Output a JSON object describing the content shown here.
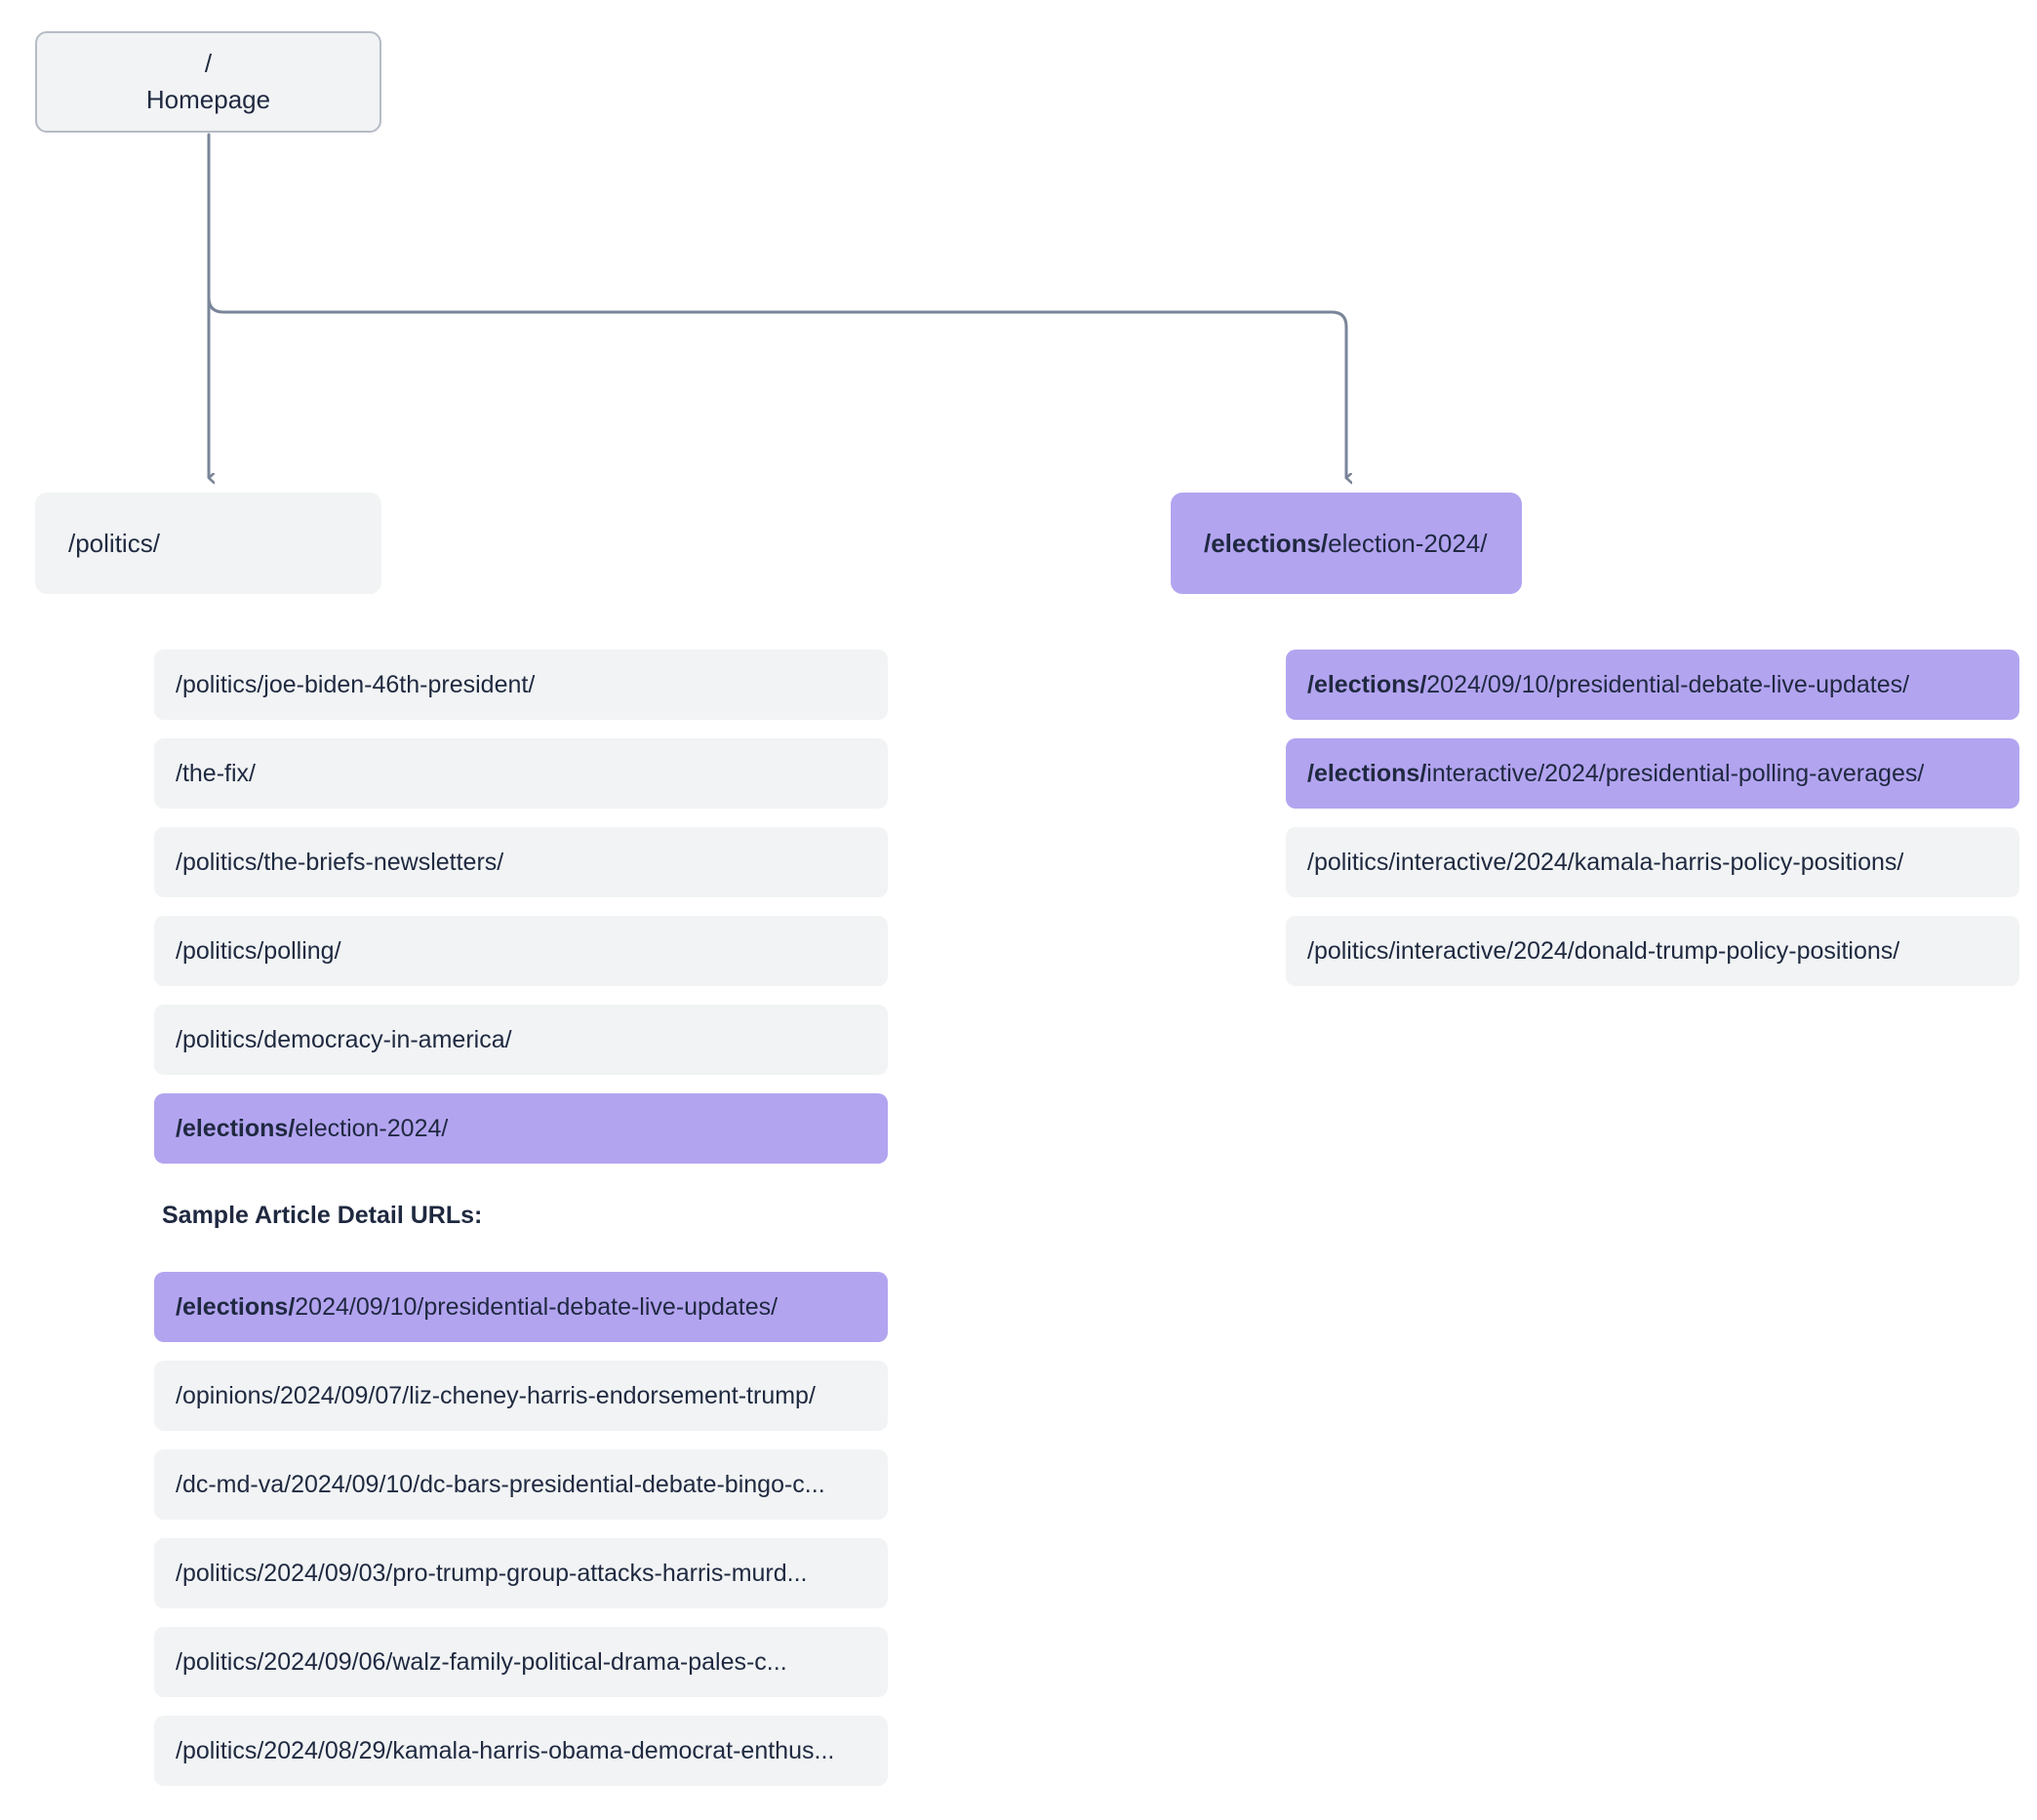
{
  "colors": {
    "highlight": "#b3a4f0",
    "neutral": "#f1f3f4",
    "text": "#1f2940",
    "connector": "#7a8599",
    "root_border": "#b6bcc6"
  },
  "root": {
    "path": "/",
    "label": "Homepage"
  },
  "sections": [
    {
      "id": "politics",
      "head": {
        "prefix": "",
        "rest": "/politics/",
        "highlight": false
      },
      "children": [
        {
          "prefix": "",
          "rest": "/politics/joe-biden-46th-president/",
          "highlight": false
        },
        {
          "prefix": "",
          "rest": "/the-fix/",
          "highlight": false
        },
        {
          "prefix": "",
          "rest": "/politics/the-briefs-newsletters/",
          "highlight": false
        },
        {
          "prefix": "",
          "rest": "/politics/polling/",
          "highlight": false
        },
        {
          "prefix": "",
          "rest": "/politics/democracy-in-america/",
          "highlight": false
        },
        {
          "prefix": "/elections/",
          "rest": "election-2024/",
          "highlight": true
        }
      ]
    },
    {
      "id": "elections",
      "head": {
        "prefix": "/elections/",
        "rest": "election-2024/",
        "highlight": true
      },
      "children": [
        {
          "prefix": "/elections/",
          "rest": "2024/09/10/presidential-debate-live-updates/",
          "highlight": true
        },
        {
          "prefix": "/elections/",
          "rest": "interactive/2024/presidential-polling-averages/",
          "highlight": true
        },
        {
          "prefix": "",
          "rest": "/politics/interactive/2024/kamala-harris-policy-positions/",
          "highlight": false
        },
        {
          "prefix": "",
          "rest": "/politics/interactive/2024/donald-trump-policy-positions/",
          "highlight": false
        }
      ]
    }
  ],
  "samples": {
    "title": "Sample Article Detail URLs:",
    "items": [
      {
        "prefix": "/elections/",
        "rest": "2024/09/10/presidential-debate-live-updates/",
        "highlight": true
      },
      {
        "prefix": "",
        "rest": "/opinions/2024/09/07/liz-cheney-harris-endorsement-trump/",
        "highlight": false
      },
      {
        "prefix": "",
        "rest": "/dc-md-va/2024/09/10/dc-bars-presidential-debate-bingo-c...",
        "highlight": false
      },
      {
        "prefix": "",
        "rest": "/politics/2024/09/03/pro-trump-group-attacks-harris-murd...",
        "highlight": false
      },
      {
        "prefix": "",
        "rest": "/politics/2024/09/06/walz-family-political-drama-pales-c...",
        "highlight": false
      },
      {
        "prefix": "",
        "rest": "/politics/2024/08/29/kamala-harris-obama-democrat-enthus...",
        "highlight": false
      }
    ]
  }
}
